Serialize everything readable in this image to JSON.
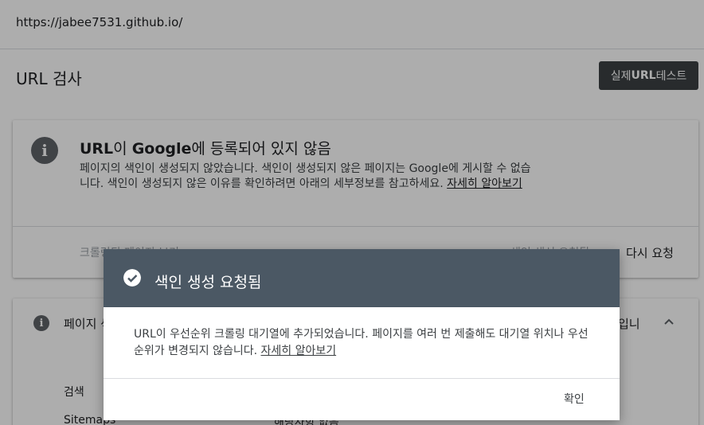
{
  "urlbar": {
    "url": "https://jabee7531.github.io/"
  },
  "header": {
    "title": "URL 검사",
    "live_test_prefix": "실제 ",
    "live_test_bold": "URL",
    "live_test_suffix": " 테스트"
  },
  "status_card": {
    "headline_part1": "URL",
    "headline_part2": "이 ",
    "headline_part3": "Google",
    "headline_part4": "에 등록되어 있지 않음",
    "description": "페이지의 색인이 생성되지 않았습니다. 색인이 생성되지 않은 페이지는 Google에 게시할 수 없습니다. 색인이 생성되지 않은 이유를 확인하려면 아래의 세부정보를 참고하세요.",
    "learn_more": "자세히 알아보기",
    "crawl_label": "크롤링된 페이지 보기",
    "request_status": "색인 생성 요청됨",
    "rerequest": "다시 요청"
  },
  "detail_card": {
    "title": "페이지 색인 생성",
    "status": "페이지가 색인이 생성되지 않음입니다",
    "status_visible": "입니",
    "row1_label": "검색",
    "row2_label": "Sitemaps",
    "row2_value": "해당사항 없음"
  },
  "dialog": {
    "title": "색인 생성 요청됨",
    "body": "URL이 우선순위 크롤링 대기열에 추가되었습니다. 페이지를 여러 번 제출해도 대기열 위치나 우선순위가 변경되지 않습니다. ",
    "learn_more": "자세히 알아보기",
    "ok": "확인"
  },
  "colors": {
    "dialog_header": "#4b5864",
    "button_dark": "#3c4043",
    "overlay": "rgba(0,0,0,0.32)"
  },
  "icons": [
    "info-icon",
    "check-circle-icon",
    "chevron-up-icon"
  ]
}
